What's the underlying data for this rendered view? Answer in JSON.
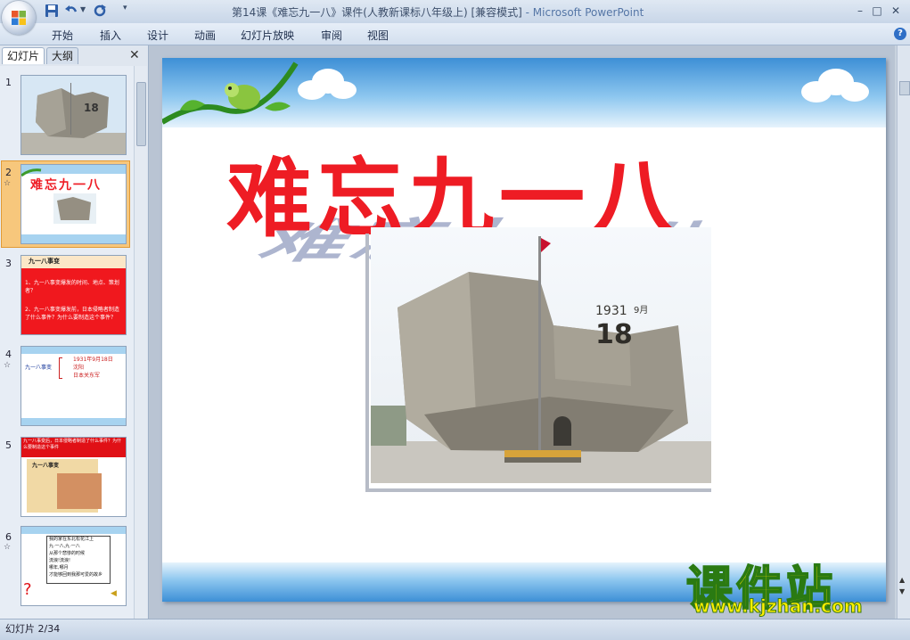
{
  "window": {
    "title": "第14课《难忘九一八》课件(人教新课标八年级上) [兼容模式]",
    "app_name": " - Microsoft PowerPoint",
    "controls": [
      "–",
      "□",
      "✕"
    ]
  },
  "ribbon": {
    "tabs": [
      "开始",
      "插入",
      "设计",
      "动画",
      "幻灯片放映",
      "审阅",
      "视图"
    ]
  },
  "panel": {
    "tab_slides": "幻灯片",
    "tab_outline": "大纲",
    "close": "✕",
    "thumbs": [
      {
        "num": "1",
        "star": "",
        "kind": "photo"
      },
      {
        "num": "2",
        "star": "☆",
        "kind": "title",
        "title": "难忘九一八",
        "selected": true
      },
      {
        "num": "3",
        "star": "",
        "kind": "red",
        "heading": "九一八事变",
        "lines": [
          "1、九一八事变爆发的时间、地点、策划者？",
          "2、九一八事变爆发前，日本侵略者制造了什么事件？为什么要制造这个事件？"
        ]
      },
      {
        "num": "4",
        "star": "☆",
        "kind": "diagram",
        "left": "九一八事变",
        "lines": [
          "1931年9月18日",
          "沈阳",
          "日本关东军"
        ]
      },
      {
        "num": "5",
        "star": "",
        "kind": "map",
        "header": "九一八事变后，日本侵略者制造了什么事件？为什么要制造这个事件",
        "heading": "九一八事变"
      },
      {
        "num": "6",
        "star": "☆",
        "kind": "poem",
        "lines": [
          "我的家在东北松花江上",
          "九·一八,九·一八",
          "从那个悲惨的时候",
          "流浪!流浪!",
          "哪年,哪月",
          "才能够回到我那可爱的故乡"
        ]
      }
    ]
  },
  "slide": {
    "title": "难忘九一八",
    "monument_text": {
      "year": "1931",
      "big": "18",
      "month": "9月",
      "day": "18"
    }
  },
  "watermark": {
    "cn": "课件站",
    "url": "www.kjzhan.com"
  },
  "status": {
    "text": "幻灯片 2/34"
  },
  "colors": {
    "title_red": "#ee1c24",
    "selection": "#f7c77c",
    "watermark_yellow": "#f7e400"
  }
}
